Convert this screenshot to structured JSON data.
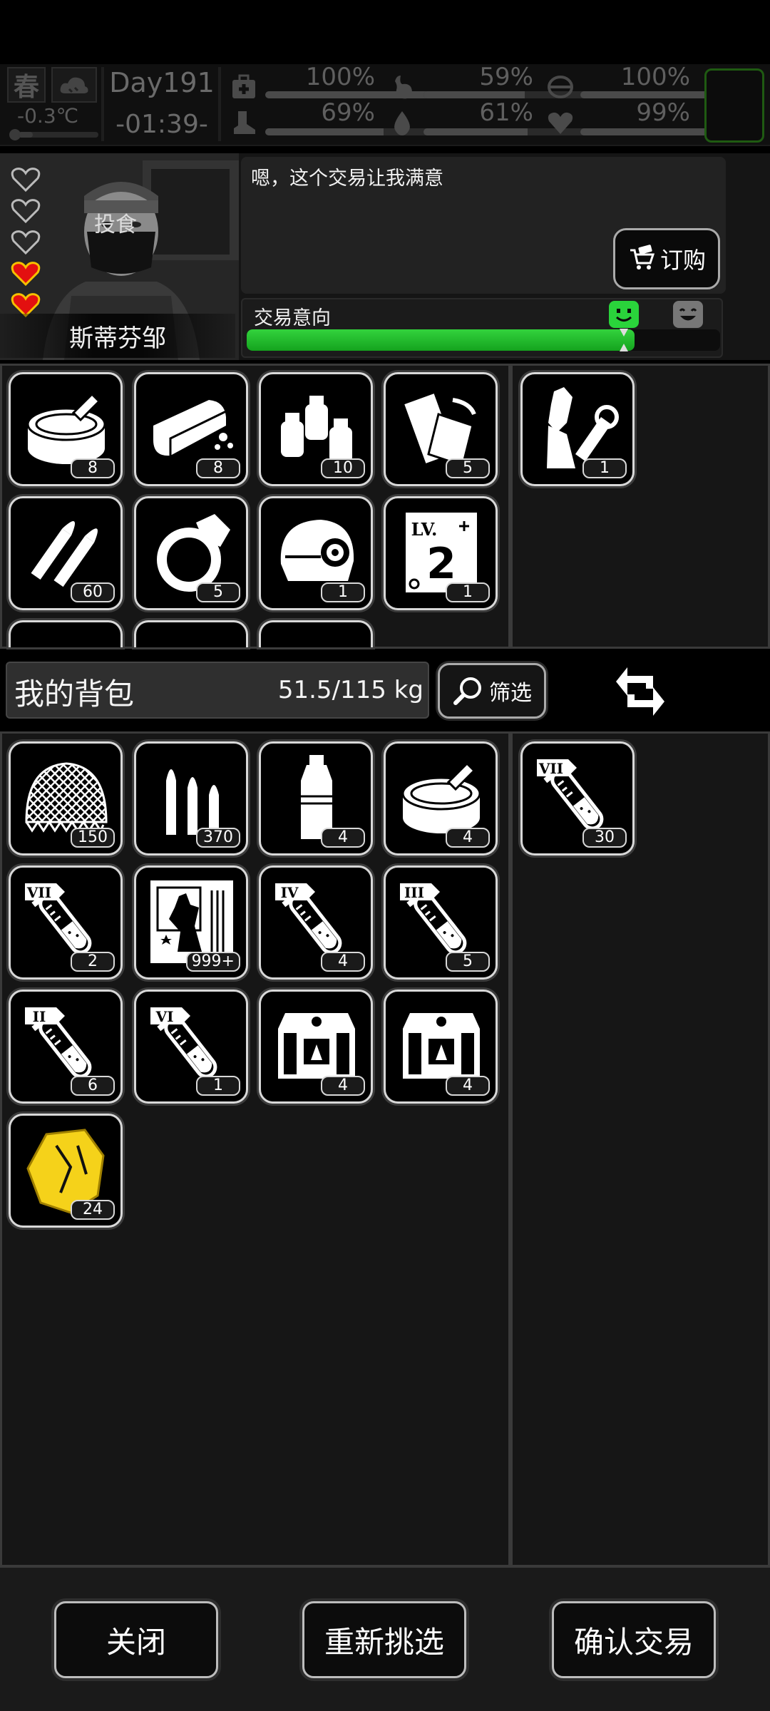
{
  "hud": {
    "season": "春",
    "temperature": "-0.3℃",
    "day": "Day191",
    "time": "-01:39-",
    "stats": [
      {
        "icon": "medkit-icon",
        "percent": "100%",
        "level": 1.0
      },
      {
        "icon": "stomach-icon",
        "percent": "59%",
        "level": 0.59
      },
      {
        "icon": "brain-icon",
        "percent": "100%",
        "level": 1.0
      },
      {
        "icon": "boot-icon",
        "percent": "69%",
        "level": 0.69
      },
      {
        "icon": "water-drop-icon",
        "percent": "61%",
        "level": 0.61
      },
      {
        "icon": "heart-icon",
        "percent": "99%",
        "level": 0.99
      }
    ]
  },
  "trader": {
    "name": "斯蒂芬邹",
    "mask_text": "投食",
    "hearts_filled": 2,
    "hearts_total": 5,
    "dialogue": "嗯，这个交易让我满意",
    "order_button": "订购",
    "intent_label": "交易意向",
    "intent_level": 0.82
  },
  "trader_items": [
    {
      "icon": "canned-food-icon",
      "qty": "8"
    },
    {
      "icon": "bread-icon",
      "qty": "8"
    },
    {
      "icon": "medicine-bottles-icon",
      "qty": "10"
    },
    {
      "icon": "bandage-roll-icon",
      "qty": "5"
    },
    {
      "icon": "bullets-icon",
      "qty": "60"
    },
    {
      "icon": "ring-icon",
      "qty": "5"
    },
    {
      "icon": "helmet-icon",
      "qty": "1"
    },
    {
      "icon": "level-card-icon",
      "qty": "1",
      "label": "LV.",
      "level": "2"
    }
  ],
  "trader_offer": [
    {
      "icon": "zombie-hand-icon",
      "qty": "1"
    }
  ],
  "bag": {
    "title": "我的背包",
    "weight": "51.5/115 kg",
    "filter_button": "筛选"
  },
  "bag_items": [
    {
      "icon": "net-icon",
      "qty": "150"
    },
    {
      "icon": "rifle-ammo-icon",
      "qty": "370"
    },
    {
      "icon": "water-bottle-icon",
      "qty": "4"
    },
    {
      "icon": "canned-food-icon",
      "qty": "4"
    },
    {
      "icon": "test-tube-icon",
      "qty": "2",
      "tier": "VII"
    },
    {
      "icon": "zombie-card-icon",
      "qty": "999+"
    },
    {
      "icon": "test-tube-icon",
      "qty": "4",
      "tier": "IV"
    },
    {
      "icon": "test-tube-icon",
      "qty": "5",
      "tier": "III"
    },
    {
      "icon": "test-tube-icon",
      "qty": "6",
      "tier": "II"
    },
    {
      "icon": "test-tube-icon",
      "qty": "1",
      "tier": "VI"
    },
    {
      "icon": "supply-crate-icon",
      "qty": "4"
    },
    {
      "icon": "supply-crate-icon",
      "qty": "4"
    },
    {
      "icon": "gold-ore-icon",
      "qty": "24"
    }
  ],
  "bag_offer": [
    {
      "icon": "test-tube-icon",
      "qty": "30",
      "tier": "VII"
    }
  ],
  "footer": {
    "close": "关闭",
    "reselect": "重新挑选",
    "confirm": "确认交易"
  }
}
